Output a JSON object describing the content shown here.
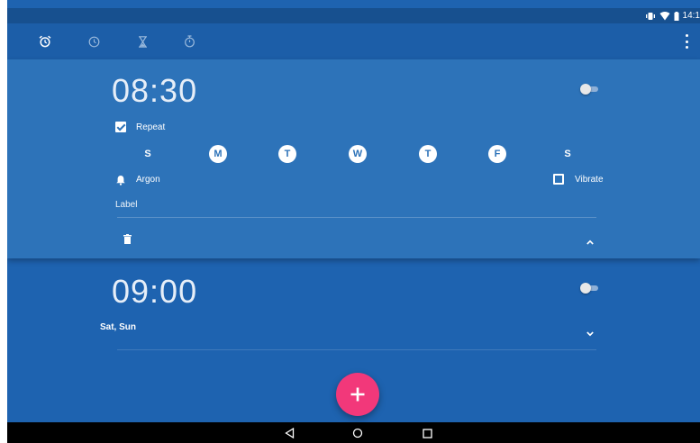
{
  "status_bar": {
    "time": "14:1",
    "icons": [
      "vibrate-icon",
      "wifi-icon",
      "battery-icon"
    ]
  },
  "toolbar": {
    "tabs": [
      {
        "icon": "alarm-icon",
        "selected": true
      },
      {
        "icon": "clock-icon",
        "selected": false
      },
      {
        "icon": "timer-icon",
        "selected": false
      },
      {
        "icon": "stopwatch-icon",
        "selected": false
      }
    ],
    "menu_icon": "overflow-menu-icon"
  },
  "alarms": [
    {
      "time": "08:30",
      "enabled": false,
      "expanded": true,
      "repeat_label": "Repeat",
      "repeat_checked": true,
      "days": [
        {
          "letter": "S",
          "active": false
        },
        {
          "letter": "M",
          "active": true
        },
        {
          "letter": "T",
          "active": true
        },
        {
          "letter": "W",
          "active": true
        },
        {
          "letter": "T",
          "active": true
        },
        {
          "letter": "F",
          "active": true
        },
        {
          "letter": "S",
          "active": false
        }
      ],
      "ringtone": "Argon",
      "vibrate_label": "Vibrate",
      "vibrate_checked": false,
      "label_placeholder": "Label"
    },
    {
      "time": "09:00",
      "enabled": false,
      "expanded": false,
      "summary": "Sat, Sun"
    }
  ],
  "colors": {
    "accent": "#f2387a",
    "primary": "#1e63b0",
    "expanded_card": "#2d73b9"
  }
}
